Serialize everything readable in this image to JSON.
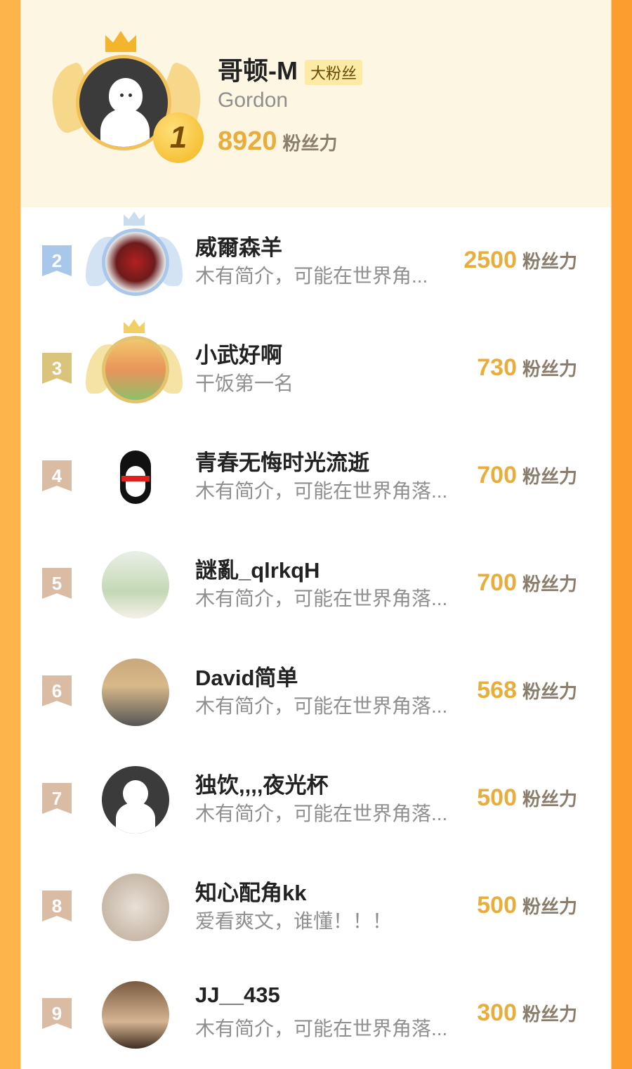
{
  "top": {
    "rank": "1",
    "name": "哥顿-M",
    "badge": "大粉丝",
    "subtitle": "Gordon",
    "score": "8920",
    "unit": "粉丝力"
  },
  "rows": [
    {
      "rank": "2",
      "name": "威爾森羊",
      "desc": "木有简介，可能在世界角...",
      "score": "2500",
      "unit": "粉丝力",
      "rank_color": "#a9c7ea"
    },
    {
      "rank": "3",
      "name": "小武好啊",
      "desc": "干饭第一名",
      "score": "730",
      "unit": "粉丝力",
      "rank_color": "#dac37a"
    },
    {
      "rank": "4",
      "name": "青春无悔时光流逝",
      "desc": "木有简介，可能在世界角落...",
      "score": "700",
      "unit": "粉丝力",
      "rank_color": "#d9bca3"
    },
    {
      "rank": "5",
      "name": "謎亂_qlrkqH",
      "desc": "木有简介，可能在世界角落...",
      "score": "700",
      "unit": "粉丝力",
      "rank_color": "#d9bca3"
    },
    {
      "rank": "6",
      "name": "David简单",
      "desc": "木有简介，可能在世界角落...",
      "score": "568",
      "unit": "粉丝力",
      "rank_color": "#d9bca3"
    },
    {
      "rank": "7",
      "name": "独饮,,,,夜光杯",
      "desc": "木有简介，可能在世界角落...",
      "score": "500",
      "unit": "粉丝力",
      "rank_color": "#d9bca3"
    },
    {
      "rank": "8",
      "name": "知心配角kk",
      "desc": "爱看爽文，谁懂！！！",
      "score": "500",
      "unit": "粉丝力",
      "rank_color": "#d9bca3"
    },
    {
      "rank": "9",
      "name": "JJ__435",
      "desc": "木有简介，可能在世界角落...",
      "score": "300",
      "unit": "粉丝力",
      "rank_color": "#d9bca3"
    }
  ],
  "colors": {
    "accent": "#e9ad3c",
    "top_bg": "#fdf6e3",
    "side_left": "#fdb44a",
    "side_right": "#fb9d2f"
  }
}
